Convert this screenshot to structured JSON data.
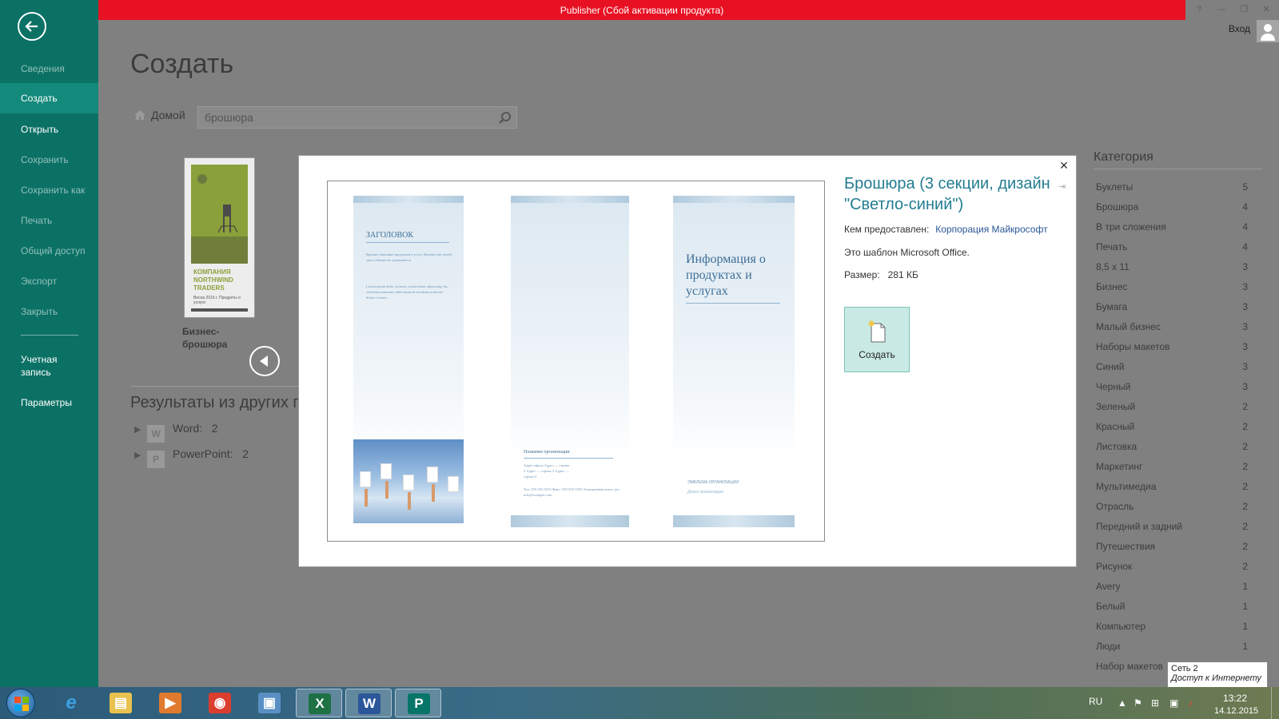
{
  "window": {
    "title": "Publisher (Сбой активации продукта)",
    "signin": "Вход",
    "controls": {
      "help": "?",
      "minimize": "—",
      "restore": "❐",
      "close": "✕"
    }
  },
  "sidebar": {
    "items": [
      {
        "label": "Сведения",
        "state": "disabled"
      },
      {
        "label": "Создать",
        "state": "active"
      },
      {
        "label": "Открыть",
        "state": "normal"
      },
      {
        "label": "Сохранить",
        "state": "disabled"
      },
      {
        "label": "Сохранить как",
        "state": "disabled"
      },
      {
        "label": "Печать",
        "state": "disabled"
      },
      {
        "label": "Общий доступ",
        "state": "disabled"
      },
      {
        "label": "Экспорт",
        "state": "disabled"
      },
      {
        "label": "Закрыть",
        "state": "disabled"
      }
    ],
    "account": "Учетная запись",
    "options": "Параметры"
  },
  "main": {
    "title": "Создать",
    "home": "Домой",
    "search_value": "брошюра",
    "thumbnail": {
      "company": "КОМПАНИЯ NORTHWIND TRADERS",
      "subtitle": "Весна 2016 г. Продукты и услуги",
      "label": "Бизнес-брошюра"
    },
    "other_results_title": "Результаты из других п",
    "other_results": [
      {
        "app": "Word:",
        "count": "2"
      },
      {
        "app": "PowerPoint:",
        "count": "2"
      }
    ]
  },
  "categories": {
    "title": "Категория",
    "items": [
      {
        "name": "Буклеты",
        "count": "5"
      },
      {
        "name": "Брошюра",
        "count": "4"
      },
      {
        "name": "В три сложения",
        "count": "4"
      },
      {
        "name": "Печать",
        "count": "4"
      },
      {
        "name": "8,5 x 11",
        "count": "3"
      },
      {
        "name": "Бизнес",
        "count": "3"
      },
      {
        "name": "Бумага",
        "count": "3"
      },
      {
        "name": "Малый бизнес",
        "count": "3"
      },
      {
        "name": "Наборы макетов",
        "count": "3"
      },
      {
        "name": "Синий",
        "count": "3"
      },
      {
        "name": "Черный",
        "count": "3"
      },
      {
        "name": "Зеленый",
        "count": "2"
      },
      {
        "name": "Красный",
        "count": "2"
      },
      {
        "name": "Листовка",
        "count": "2"
      },
      {
        "name": "Маркетинг",
        "count": "2"
      },
      {
        "name": "Мультимедиа",
        "count": "2"
      },
      {
        "name": "Отрасль",
        "count": "2"
      },
      {
        "name": "Передний и задний",
        "count": "2"
      },
      {
        "name": "Путешествия",
        "count": "2"
      },
      {
        "name": "Рисунок",
        "count": "2"
      },
      {
        "name": "Avery",
        "count": "1"
      },
      {
        "name": "Белый",
        "count": "1"
      },
      {
        "name": "Компьютер",
        "count": "1"
      },
      {
        "name": "Люди",
        "count": "1"
      },
      {
        "name": "Набор макетов",
        "count": ""
      }
    ]
  },
  "modal": {
    "title": "Брошюра (3 секции, дизайн \"Светло-синий\")",
    "provided_by_label": "Кем предоставлен:",
    "provided_by_value": "Корпорация Майкрософт",
    "description": "Это шаблон Microsoft Office.",
    "size_label": "Размер:",
    "size_value": "281 КБ",
    "create_label": "Создать",
    "preview": {
      "heading": "ЗАГОЛОВОК",
      "body1": "Краткое описание продуктов и услуг. Количество полей здесь обычно не указывается.",
      "body2": "Lorem ipsum dolor sit amet, consectetuer adipiscing elit, sed diam nonummy nibh euismod tincidunt ut laoreet dolore et iusto.",
      "org_name": "Название организации",
      "address": "Адрес офиса Адрес — строка 2 Адрес — строка 3 Адрес — строка 4",
      "phone": "Тел: 555-555-5555 Факс: 555-555-5555 Электронная почта: pro-info@example.com",
      "panel3_title": "Информация о продуктах и услугах",
      "panel3_org": "ЭМБЛЕМА ОРГАНИЗАЦИИ",
      "panel3_slogan": "Девиз организации"
    }
  },
  "tooltip": {
    "line1": "Сеть  2",
    "line2": "Доступ к Интернету"
  },
  "taskbar": {
    "lang": "RU",
    "time": "13:22",
    "date": "14.12.2015",
    "apps": [
      {
        "name": "file-explorer",
        "glyph": "▤",
        "color": "#e8c14f"
      },
      {
        "name": "media-player",
        "glyph": "▶",
        "color": "#e07a2e"
      },
      {
        "name": "chrome",
        "glyph": "◉",
        "color": "#db3d2f"
      },
      {
        "name": "store",
        "glyph": "▣",
        "color": "#5a8fc4"
      },
      {
        "name": "excel",
        "glyph": "X",
        "color": "#1e7145"
      },
      {
        "name": "word",
        "glyph": "W",
        "color": "#2b579a"
      },
      {
        "name": "publisher",
        "glyph": "P",
        "color": "#077568"
      }
    ]
  },
  "colors": {
    "accent": "#0b7165",
    "title_bar": "#e81123",
    "link": "#2b5797",
    "template_title": "#237d91"
  }
}
